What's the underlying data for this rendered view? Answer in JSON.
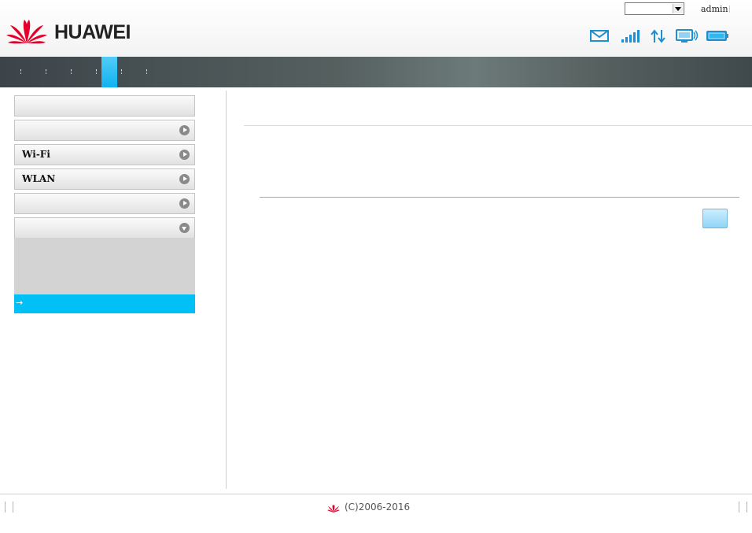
{
  "header": {
    "brand": "HUAWEI",
    "user": "admin",
    "language_selected": ""
  },
  "status_icons": [
    "envelope-icon",
    "signal-strength-icon",
    "data-transfer-icon",
    "pc-connection-icon",
    "battery-icon"
  ],
  "nav": {
    "tab_count": 6,
    "active_index": 4
  },
  "sidebar": {
    "items": [
      {
        "label": "",
        "arrow": "none"
      },
      {
        "label": "",
        "arrow": "right"
      },
      {
        "label": "Wi-Fi",
        "arrow": "right"
      },
      {
        "label": "WLAN",
        "arrow": "right"
      },
      {
        "label": "",
        "arrow": "right"
      },
      {
        "label": "",
        "arrow": "down"
      }
    ],
    "submenu_active_label": ""
  },
  "content": {
    "apply_label": ""
  },
  "footer": {
    "copyright": "(C)2006-2016"
  },
  "colors": {
    "accent": "#00c0f5",
    "brand_red": "#e4002b",
    "nav_bg": "#55605f"
  }
}
